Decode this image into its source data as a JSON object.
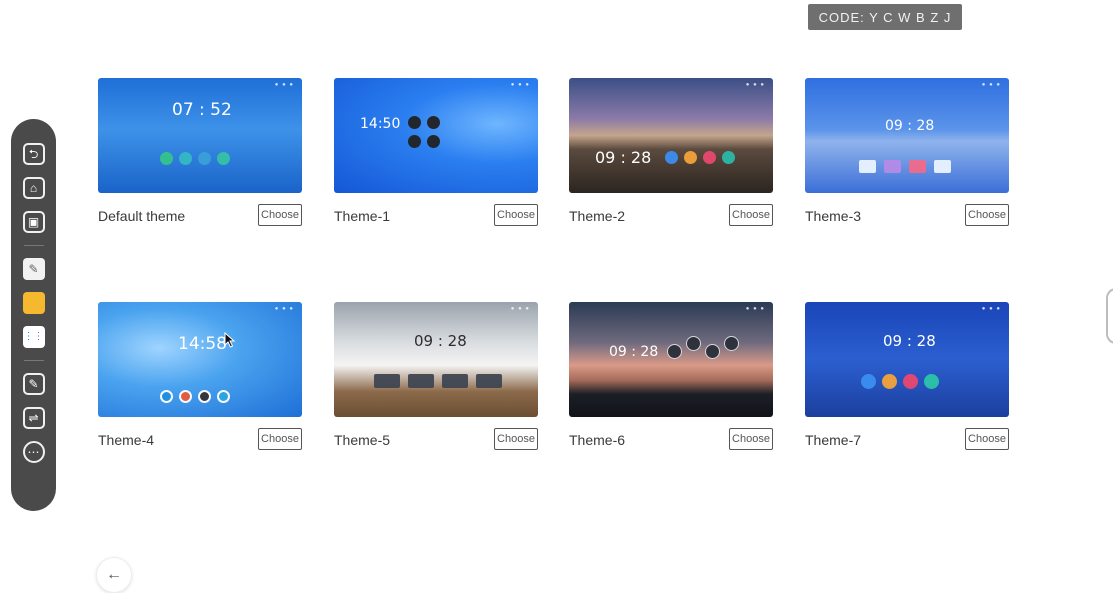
{
  "code_badge": "CODE: Y C W B Z J",
  "toolbar": {
    "items": [
      {
        "name": "back-icon",
        "glyph": "⮌"
      },
      {
        "name": "home-icon",
        "glyph": "⌂"
      },
      {
        "name": "windows-icon",
        "glyph": "▣"
      },
      {
        "name": "whiteboard-app-icon",
        "glyph": "✎"
      },
      {
        "name": "notes-app-icon",
        "glyph": ""
      },
      {
        "name": "apps-grid-icon",
        "glyph": "⋮⋮"
      },
      {
        "name": "pen-icon",
        "glyph": "✎"
      },
      {
        "name": "settings-sliders-icon",
        "glyph": "⇌"
      },
      {
        "name": "more-icon",
        "glyph": "⋯"
      }
    ]
  },
  "themes": [
    {
      "label": "Default theme",
      "button": "Choose",
      "clock": "07 : 52"
    },
    {
      "label": "Theme-1",
      "button": "Choose",
      "clock": "14:50"
    },
    {
      "label": "Theme-2",
      "button": "Choose",
      "clock": "09 : 28"
    },
    {
      "label": "Theme-3",
      "button": "Choose",
      "clock": "09 : 28"
    },
    {
      "label": "Theme-4",
      "button": "Choose",
      "clock": "14:58"
    },
    {
      "label": "Theme-5",
      "button": "Choose",
      "clock": "09 : 28"
    },
    {
      "label": "Theme-6",
      "button": "Choose",
      "clock": "09 : 28"
    },
    {
      "label": "Theme-7",
      "button": "Choose",
      "clock": "09 : 28"
    }
  ],
  "back_button": "←"
}
